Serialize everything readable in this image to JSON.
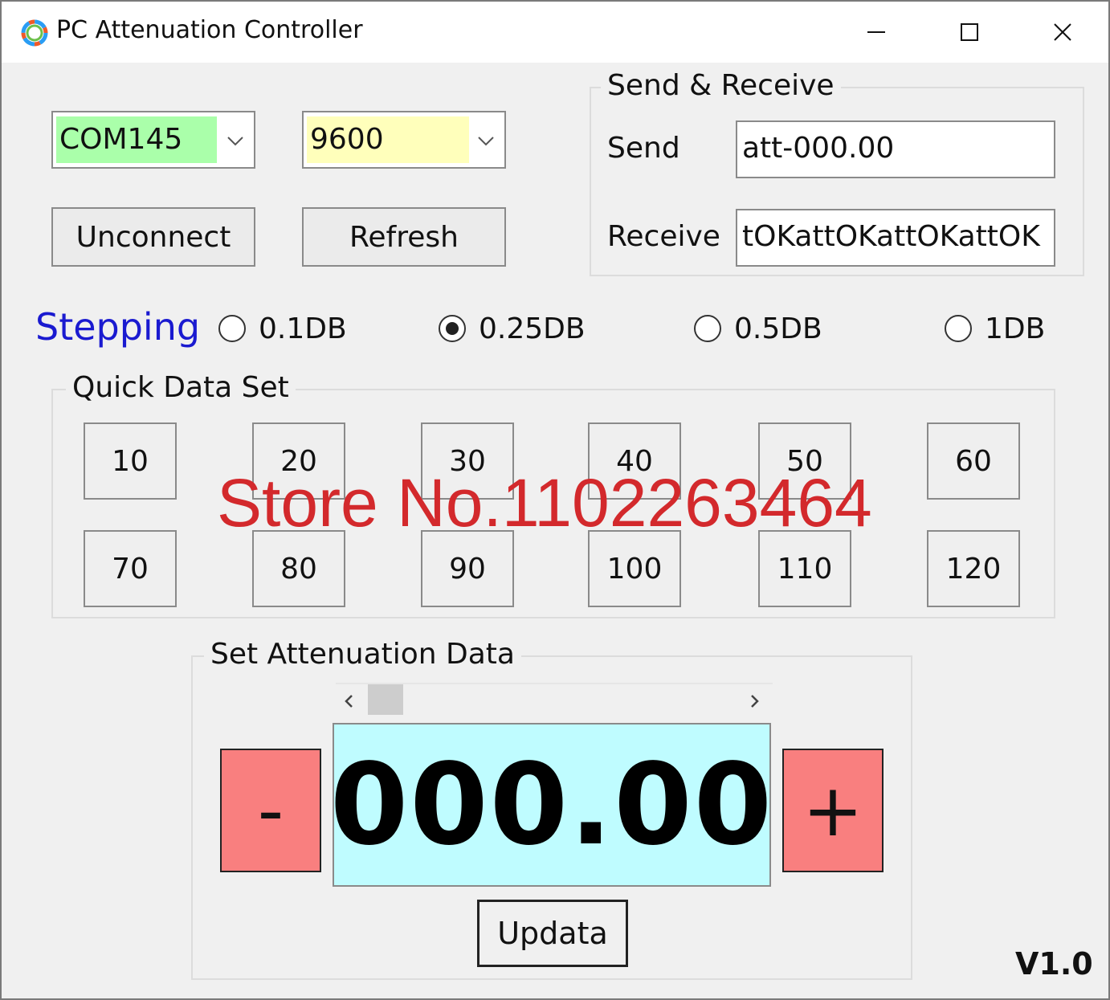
{
  "window": {
    "title": "PC Attenuation Controller"
  },
  "serial": {
    "port": "COM145",
    "port_bg": "#aaffaa",
    "baud": "9600",
    "baud_bg": "#ffffbb",
    "connect_button": "Unconnect",
    "refresh_button": "Refresh"
  },
  "send_receive": {
    "group_title": "Send & Receive",
    "send_label": "Send",
    "send_value": "att-000.00",
    "receive_label": "Receive",
    "receive_value": "tOKattOKattOKattOK"
  },
  "stepping": {
    "label": "Stepping",
    "options": [
      "0.1DB",
      "0.25DB",
      "0.5DB",
      "1DB"
    ],
    "selected": "0.25DB"
  },
  "quick_data": {
    "group_title": "Quick Data Set",
    "values": [
      "10",
      "20",
      "30",
      "40",
      "50",
      "60",
      "70",
      "80",
      "90",
      "100",
      "110",
      "120"
    ]
  },
  "attenuation": {
    "group_title": "Set Attenuation Data",
    "minus_label": "-",
    "plus_label": "+",
    "value": "000.00",
    "update_button": "Updata",
    "display_bg": "#bffcff",
    "button_bg": "#f97f7f"
  },
  "version": "V1.0",
  "watermark": "Store No.1102263464"
}
